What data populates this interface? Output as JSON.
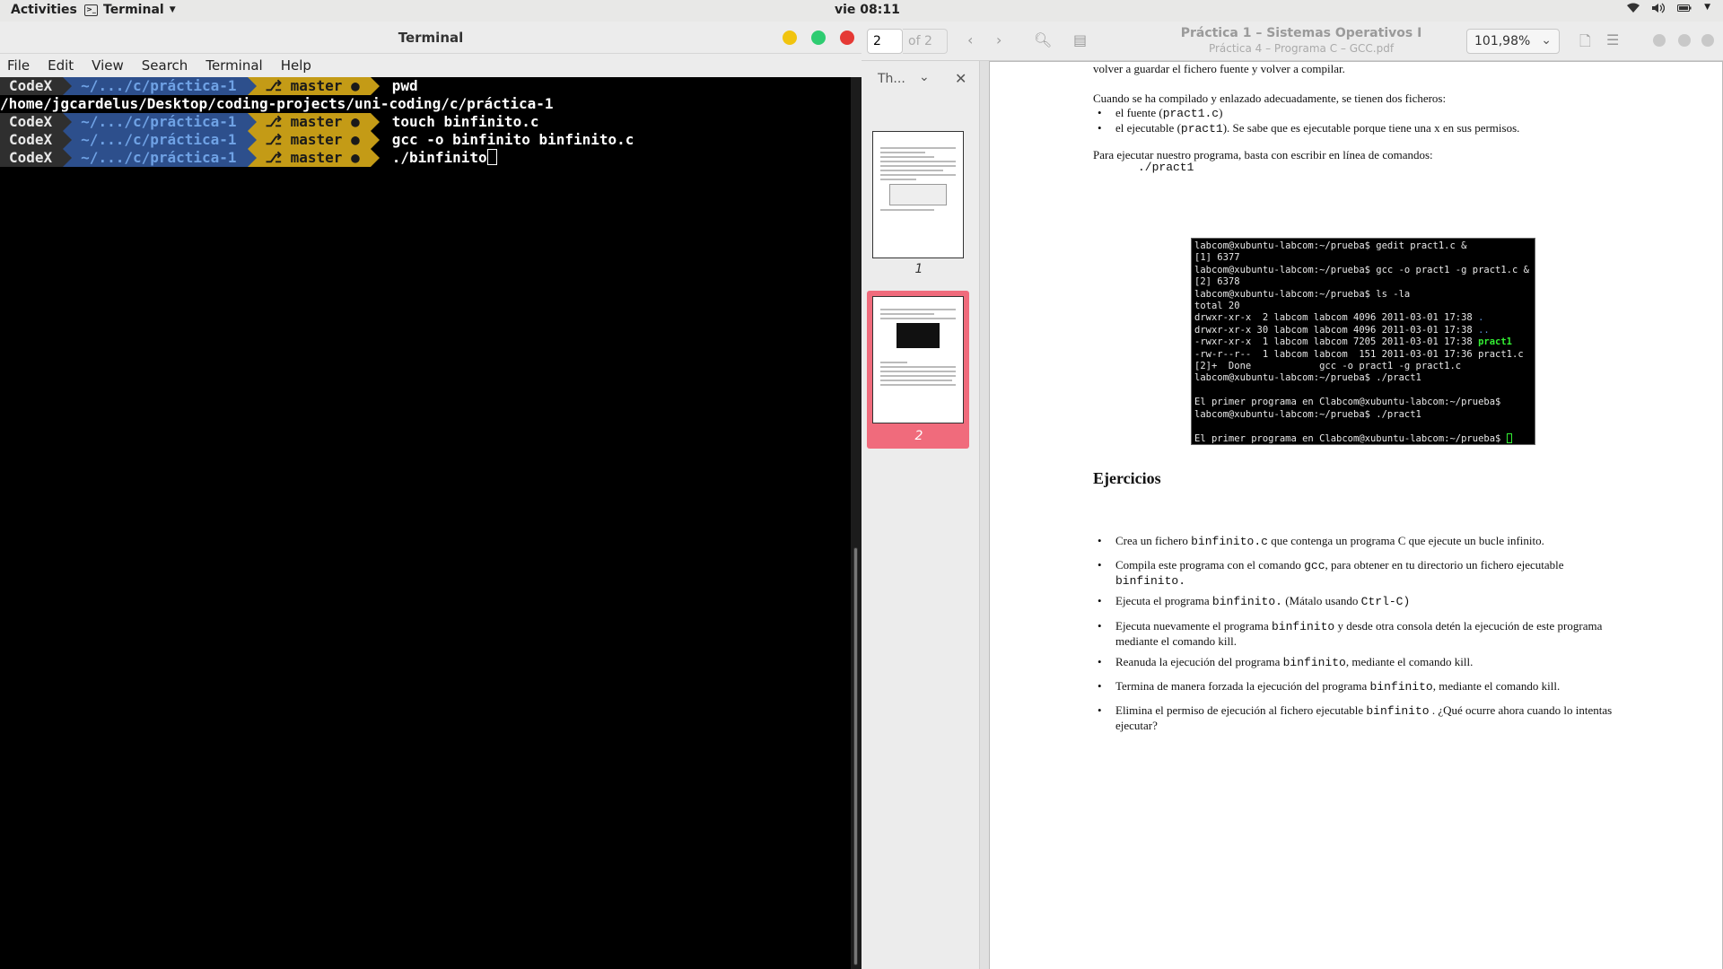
{
  "topbar": {
    "activities": "Activities",
    "app_name": "Terminal",
    "clock": "vie 08:11"
  },
  "terminal": {
    "title": "Terminal",
    "menu": [
      "File",
      "Edit",
      "View",
      "Search",
      "Terminal",
      "Help"
    ],
    "prompt": {
      "user": "CodeX",
      "path": "~/.../c/práctica-1",
      "branch": "⎇ master ●"
    },
    "lines": [
      {
        "cmd": "pwd"
      },
      {
        "output": "/home/jgcardelus/Desktop/coding-projects/uni-coding/c/práctica-1"
      },
      {
        "cmd": "touch binfinito.c"
      },
      {
        "cmd": "gcc -o binfinito binfinito.c"
      },
      {
        "cmd": "./binfinito"
      }
    ],
    "colors": {
      "dark": "#2f2f2f",
      "blue": "#2d4f8c",
      "yellow": "#c49b16",
      "close": "#e53935",
      "max": "#2ecc71",
      "min": "#f1c40f"
    }
  },
  "viewer": {
    "page_current": "2",
    "page_of": "of 2",
    "title": "Práctica 1 – Sistemas Operativos I",
    "subtitle": "Práctica 4 – Programa C – GCC.pdf",
    "zoom": "101,98%",
    "sidebar_label": "Th...",
    "thumb_numbers": [
      "1",
      "2"
    ],
    "doc": {
      "top_fragment": "volver a guardar el fichero fuente y volver a compilar.",
      "compiled_intro": "Cuando se ha compilado y enlazado adecuadamente, se tienen dos ficheros:",
      "file_items": [
        {
          "pre": "el fuente (",
          "code": "pract1.c",
          "post": ")"
        },
        {
          "pre": "el ejecutable (",
          "code": "pract1",
          "post": "). Se sabe que es ejecutable porque tiene una x en sus permisos."
        }
      ],
      "run_intro": "Para ejecutar nuestro programa, basta con escribir en línea de comandos:",
      "run_cmd": "./pract1",
      "shot_lines": [
        "labcom@xubuntu-labcom:~/prueba$ gedit pract1.c &",
        "[1] 6377",
        "labcom@xubuntu-labcom:~/prueba$ gcc -o pract1 -g pract1.c &",
        "[2] 6378",
        "labcom@xubuntu-labcom:~/prueba$ ls -la",
        "total 20",
        "drwxr-xr-x  2 labcom labcom 4096 2011-03-01 17:38 .",
        "drwxr-xr-x 30 labcom labcom 4096 2011-03-01 17:38 ..",
        "-rwxr-xr-x  1 labcom labcom 7205 2011-03-01 17:38 pract1",
        "-rw-r--r--  1 labcom labcom  151 2011-03-01 17:36 pract1.c",
        "[2]+  Done            gcc -o pract1 -g pract1.c",
        "labcom@xubuntu-labcom:~/prueba$ ./pract1",
        "",
        "El primer programa en Clabcom@xubuntu-labcom:~/prueba$",
        "labcom@xubuntu-labcom:~/prueba$ ./pract1",
        "",
        "El primer programa en Clabcom@xubuntu-labcom:~/prueba$ "
      ],
      "exercises_title": "Ejercicios",
      "exercises": [
        [
          {
            "t": "Crea un fichero "
          },
          {
            "c": "binfinito.c"
          },
          {
            "t": "  que contenga un programa C que ejecute un bucle infinito."
          }
        ],
        [
          {
            "t": "Compila este programa con el comando "
          },
          {
            "c": "gcc"
          },
          {
            "t": ", para obtener en tu directorio un fichero ejecutable "
          },
          {
            "c": "binfinito."
          }
        ],
        [
          {
            "t": "Ejecuta el programa "
          },
          {
            "c": "binfinito."
          },
          {
            "t": "  (Mátalo usando  "
          },
          {
            "c": "Ctrl-C)"
          }
        ],
        [
          {
            "t": "Ejecuta nuevamente el programa "
          },
          {
            "c": "binfinito"
          },
          {
            "t": "  y desde otra consola detén la ejecución de este programa mediante el comando kill."
          }
        ],
        [
          {
            "t": "Reanuda la ejecución del programa "
          },
          {
            "c": "binfinito"
          },
          {
            "t": ", mediante el comando kill."
          }
        ],
        [
          {
            "t": "Termina de manera forzada la ejecución del programa "
          },
          {
            "c": "binfinito"
          },
          {
            "t": ", mediante el comando kill."
          }
        ],
        [
          {
            "t": "Elimina el permiso de ejecución al fichero ejecutable  "
          },
          {
            "c": "binfinito"
          },
          {
            "t": " . ¿Qué ocurre ahora cuando lo intentas ejecutar?"
          }
        ]
      ]
    }
  }
}
